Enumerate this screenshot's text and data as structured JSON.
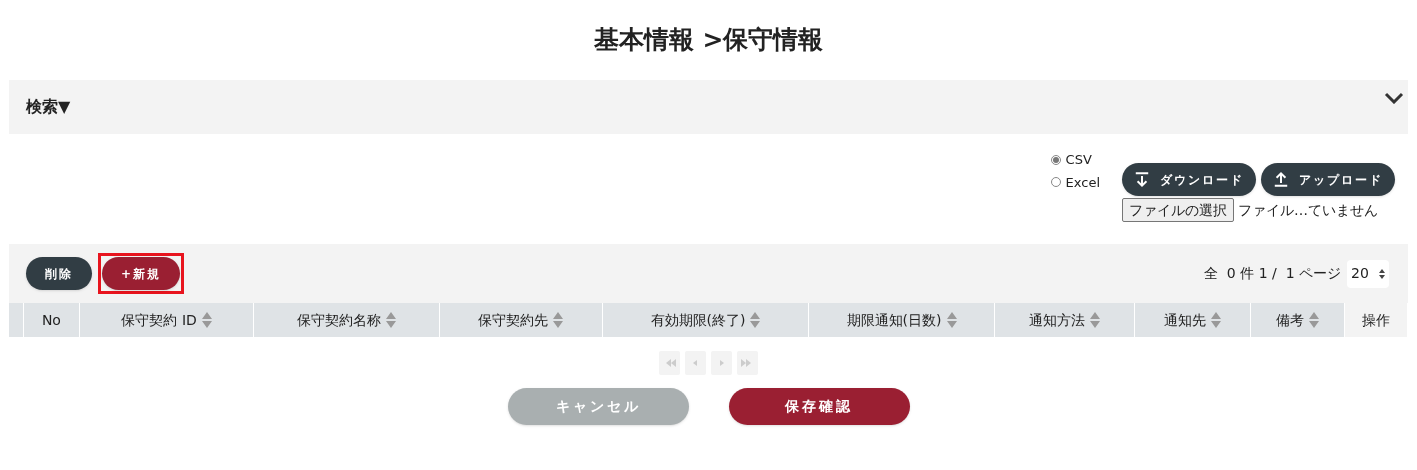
{
  "page_title": "基本情報 >保守情報",
  "search_panel": {
    "label": "検索▼",
    "expanded": false
  },
  "export": {
    "formats": [
      {
        "label": "CSV",
        "selected": true
      },
      {
        "label": "Excel",
        "selected": false
      }
    ],
    "buttons": [
      {
        "kind": "download",
        "label": "ダウンロード"
      },
      {
        "kind": "upload",
        "label": "アップロード"
      }
    ],
    "file_button": "ファイルの選択",
    "file_status": "ファイル…ていません"
  },
  "toolbar": {
    "buttons": [
      {
        "kind": "delete",
        "label": "削除",
        "highlighted": false
      },
      {
        "kind": "new",
        "label": "+新規",
        "highlighted": true
      }
    ],
    "paging_info": "全  0 件 1 /  1 ページ",
    "page_size": "20"
  },
  "table": {
    "columns": [
      {
        "label": "No",
        "sortable": false
      },
      {
        "label": "保守契約 ID",
        "sortable": true
      },
      {
        "label": "保守契約名称",
        "sortable": true
      },
      {
        "label": "保守契約先",
        "sortable": true
      },
      {
        "label": "有効期限(終了)",
        "sortable": true
      },
      {
        "label": "期限通知(日数)",
        "sortable": true
      },
      {
        "label": "通知方法",
        "sortable": true
      },
      {
        "label": "通知先",
        "sortable": true
      },
      {
        "label": "備考",
        "sortable": true
      },
      {
        "label": "操作",
        "sortable": false
      }
    ]
  },
  "pagination": [
    {
      "kind": "first",
      "disabled": true
    },
    {
      "kind": "prev",
      "disabled": true
    },
    {
      "kind": "next",
      "disabled": true
    },
    {
      "kind": "last",
      "disabled": true
    }
  ],
  "footer_buttons": [
    {
      "kind": "cancel",
      "label": "キャンセル"
    },
    {
      "kind": "confirm",
      "label": "保存確認"
    }
  ]
}
